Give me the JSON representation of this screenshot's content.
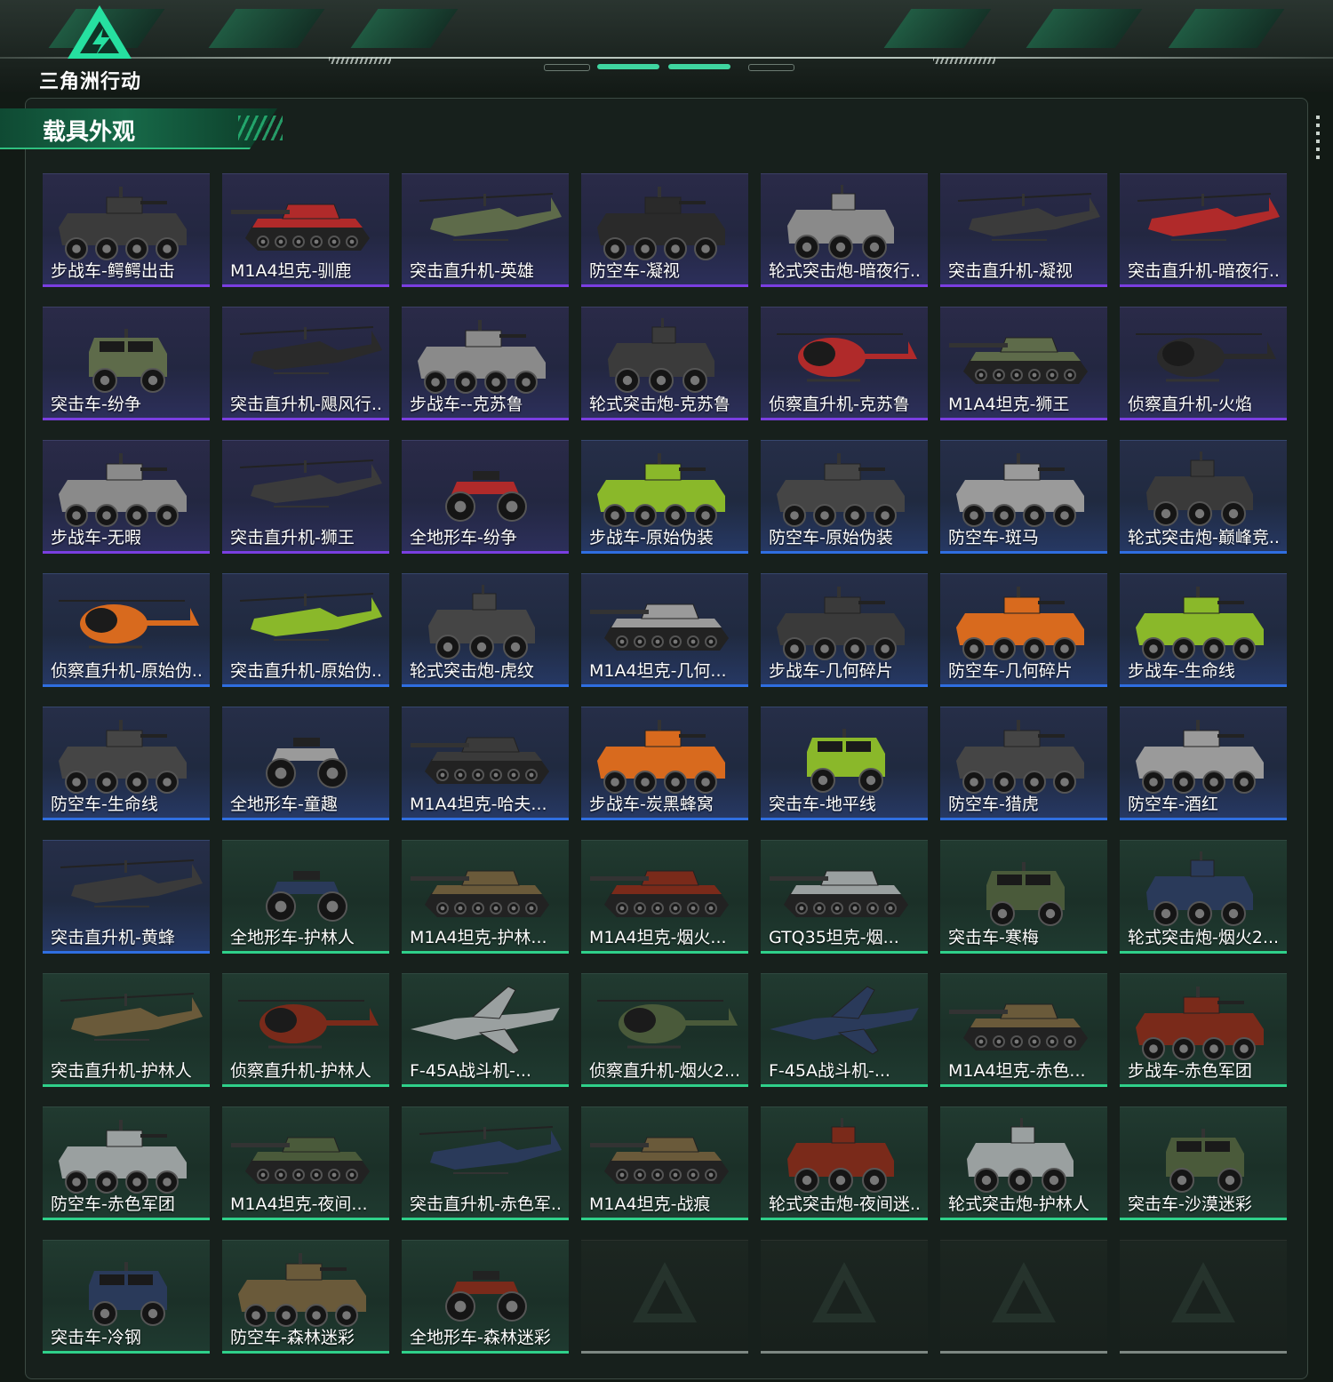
{
  "app": {
    "logo_text": "三角洲行动"
  },
  "section": {
    "title": "载具外观"
  },
  "rarity_colors": {
    "purple": "#7a3ee0",
    "blue": "#2f6ee0",
    "green": "#2fd08a",
    "empty": "#7d8782"
  },
  "cards": [
    {
      "label": "步战车-鳄鳄出击",
      "rarity": "purple",
      "vehicle": "ifv"
    },
    {
      "label": "M1A4坦克-驯鹿",
      "rarity": "purple",
      "vehicle": "tank"
    },
    {
      "label": "突击直升机-英雄",
      "rarity": "purple",
      "vehicle": "heli"
    },
    {
      "label": "防空车-凝视",
      "rarity": "purple",
      "vehicle": "ifv"
    },
    {
      "label": "轮式突击炮-暗夜行...",
      "rarity": "purple",
      "vehicle": "apc"
    },
    {
      "label": "突击直升机-凝视",
      "rarity": "purple",
      "vehicle": "heli"
    },
    {
      "label": "突击直升机-暗夜行...",
      "rarity": "purple",
      "vehicle": "heli"
    },
    {
      "label": "突击车-纷争",
      "rarity": "purple",
      "vehicle": "truck"
    },
    {
      "label": "突击直升机-飓风行...",
      "rarity": "purple",
      "vehicle": "heli"
    },
    {
      "label": "步战车--克苏鲁",
      "rarity": "purple",
      "vehicle": "ifv"
    },
    {
      "label": "轮式突击炮-克苏鲁",
      "rarity": "purple",
      "vehicle": "apc"
    },
    {
      "label": "侦察直升机-克苏鲁",
      "rarity": "purple",
      "vehicle": "scout"
    },
    {
      "label": "M1A4坦克-狮王",
      "rarity": "purple",
      "vehicle": "tank"
    },
    {
      "label": "侦察直升机-火焰",
      "rarity": "purple",
      "vehicle": "scout"
    },
    {
      "label": "步战车-无暇",
      "rarity": "purple",
      "vehicle": "ifv"
    },
    {
      "label": "突击直升机-狮王",
      "rarity": "purple",
      "vehicle": "heli"
    },
    {
      "label": "全地形车-纷争",
      "rarity": "purple",
      "vehicle": "atv"
    },
    {
      "label": "步战车-原始伪装",
      "rarity": "blue",
      "vehicle": "ifv"
    },
    {
      "label": "防空车-原始伪装",
      "rarity": "blue",
      "vehicle": "ifv"
    },
    {
      "label": "防空车-斑马",
      "rarity": "blue",
      "vehicle": "ifv"
    },
    {
      "label": "轮式突击炮-巅峰竞...",
      "rarity": "blue",
      "vehicle": "apc"
    },
    {
      "label": "侦察直升机-原始伪...",
      "rarity": "blue",
      "vehicle": "scout"
    },
    {
      "label": "突击直升机-原始伪...",
      "rarity": "blue",
      "vehicle": "heli"
    },
    {
      "label": "轮式突击炮-虎纹",
      "rarity": "blue",
      "vehicle": "apc"
    },
    {
      "label": "M1A4坦克-几何...",
      "rarity": "blue",
      "vehicle": "tank"
    },
    {
      "label": "步战车-几何碎片",
      "rarity": "blue",
      "vehicle": "ifv"
    },
    {
      "label": "防空车-几何碎片",
      "rarity": "blue",
      "vehicle": "ifv"
    },
    {
      "label": "步战车-生命线",
      "rarity": "blue",
      "vehicle": "ifv"
    },
    {
      "label": "防空车-生命线",
      "rarity": "blue",
      "vehicle": "ifv"
    },
    {
      "label": "全地形车-童趣",
      "rarity": "blue",
      "vehicle": "atv"
    },
    {
      "label": "M1A4坦克-哈夫...",
      "rarity": "blue",
      "vehicle": "tank"
    },
    {
      "label": "步战车-炭黑蜂窝",
      "rarity": "blue",
      "vehicle": "ifv"
    },
    {
      "label": "突击车-地平线",
      "rarity": "blue",
      "vehicle": "truck"
    },
    {
      "label": "防空车-猎虎",
      "rarity": "blue",
      "vehicle": "ifv"
    },
    {
      "label": "防空车-酒红",
      "rarity": "blue",
      "vehicle": "ifv"
    },
    {
      "label": "突击直升机-黄蜂",
      "rarity": "blue",
      "vehicle": "heli"
    },
    {
      "label": "全地形车-护林人",
      "rarity": "green",
      "vehicle": "atv"
    },
    {
      "label": "M1A4坦克-护林...",
      "rarity": "green",
      "vehicle": "tank"
    },
    {
      "label": "M1A4坦克-烟火...",
      "rarity": "green",
      "vehicle": "tank"
    },
    {
      "label": "GTQ35坦克-烟...",
      "rarity": "green",
      "vehicle": "tank"
    },
    {
      "label": "突击车-寒梅",
      "rarity": "green",
      "vehicle": "truck"
    },
    {
      "label": "轮式突击炮-烟火2...",
      "rarity": "green",
      "vehicle": "apc"
    },
    {
      "label": "突击直升机-护林人",
      "rarity": "green",
      "vehicle": "heli"
    },
    {
      "label": "侦察直升机-护林人",
      "rarity": "green",
      "vehicle": "scout"
    },
    {
      "label": "F-45A战斗机-...",
      "rarity": "green",
      "vehicle": "jet"
    },
    {
      "label": "侦察直升机-烟火2...",
      "rarity": "green",
      "vehicle": "scout"
    },
    {
      "label": "F-45A战斗机-...",
      "rarity": "green",
      "vehicle": "jet"
    },
    {
      "label": "M1A4坦克-赤色...",
      "rarity": "green",
      "vehicle": "tank"
    },
    {
      "label": "步战车-赤色军团",
      "rarity": "green",
      "vehicle": "ifv"
    },
    {
      "label": "防空车-赤色军团",
      "rarity": "green",
      "vehicle": "ifv"
    },
    {
      "label": "M1A4坦克-夜间...",
      "rarity": "green",
      "vehicle": "tank"
    },
    {
      "label": "突击直升机-赤色军...",
      "rarity": "green",
      "vehicle": "heli"
    },
    {
      "label": "M1A4坦克-战痕",
      "rarity": "green",
      "vehicle": "tank"
    },
    {
      "label": "轮式突击炮-夜间迷...",
      "rarity": "green",
      "vehicle": "apc"
    },
    {
      "label": "轮式突击炮-护林人",
      "rarity": "green",
      "vehicle": "apc"
    },
    {
      "label": "突击车-沙漠迷彩",
      "rarity": "green",
      "vehicle": "truck"
    },
    {
      "label": "突击车-冷钢",
      "rarity": "green",
      "vehicle": "truck"
    },
    {
      "label": "防空车-森林迷彩",
      "rarity": "green",
      "vehicle": "ifv"
    },
    {
      "label": "全地形车-森林迷彩",
      "rarity": "green",
      "vehicle": "atv"
    },
    {
      "label": "",
      "rarity": "empty",
      "vehicle": "none"
    },
    {
      "label": "",
      "rarity": "empty",
      "vehicle": "none"
    },
    {
      "label": "",
      "rarity": "empty",
      "vehicle": "none"
    },
    {
      "label": "",
      "rarity": "empty",
      "vehicle": "none"
    }
  ]
}
